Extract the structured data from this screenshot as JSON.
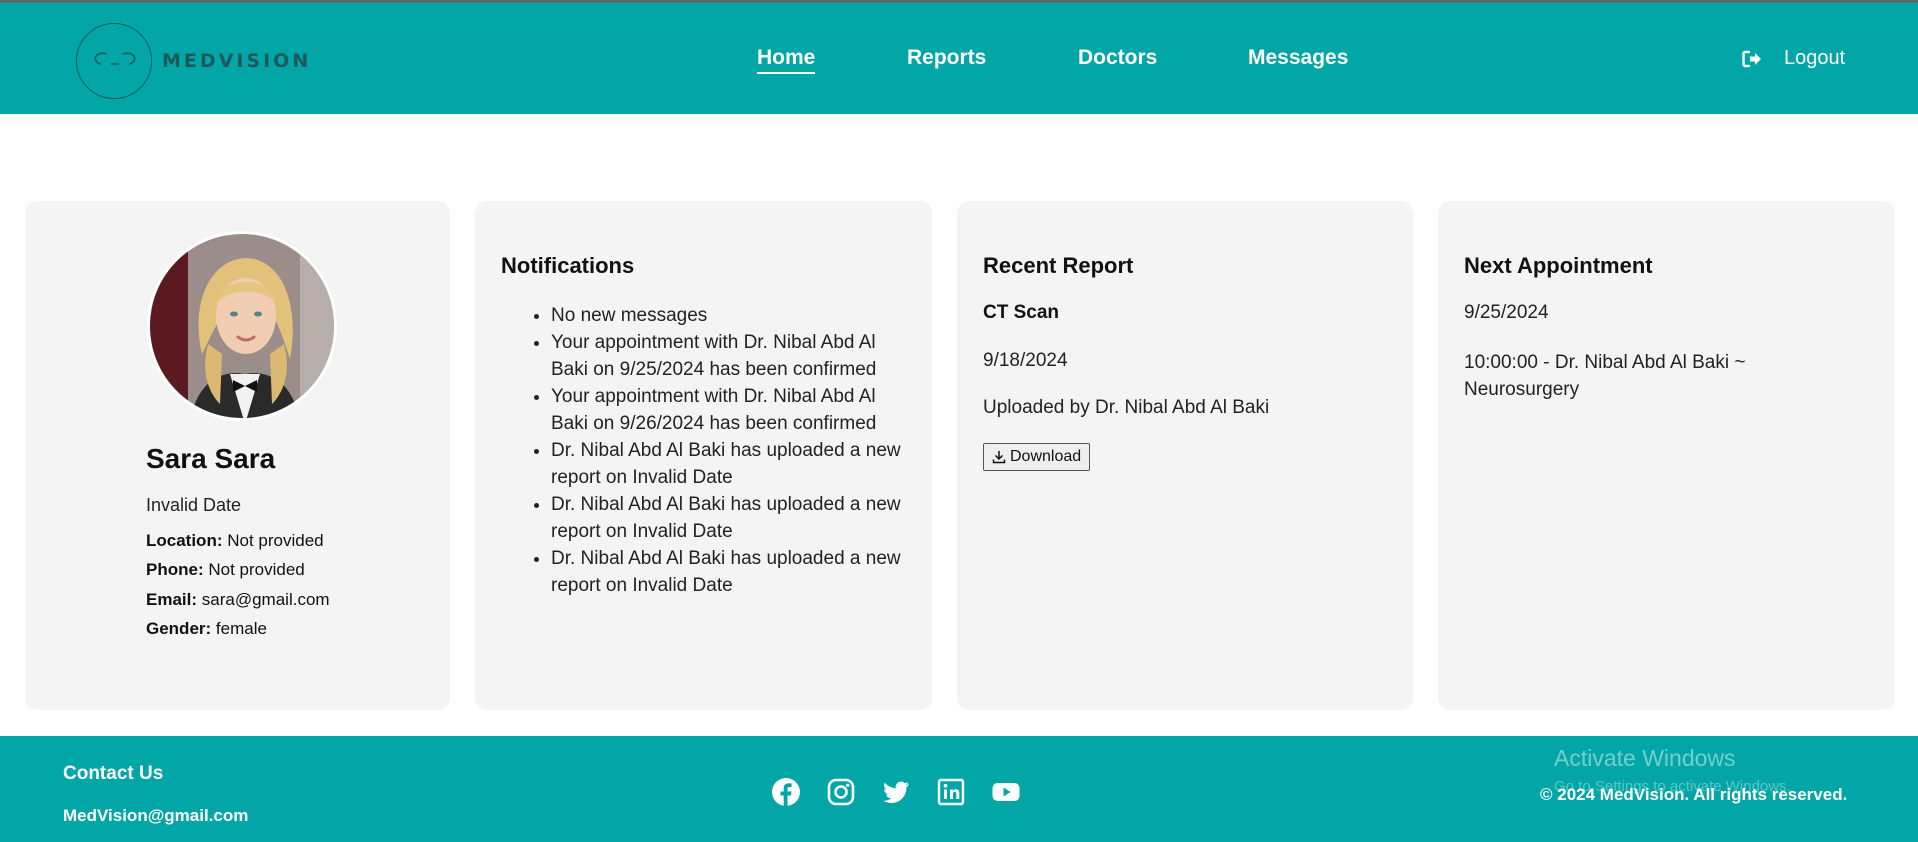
{
  "brand": {
    "name": "MEDVISION"
  },
  "nav": {
    "items": [
      {
        "label": "Home",
        "active": true
      },
      {
        "label": "Reports"
      },
      {
        "label": "Doctors"
      },
      {
        "label": "Messages"
      }
    ],
    "logout_label": "Logout"
  },
  "profile": {
    "name": "Sara Sara",
    "dob": "Invalid Date",
    "fields": [
      {
        "label": "Location:",
        "value": "Not provided"
      },
      {
        "label": "Phone:",
        "value": "Not provided"
      },
      {
        "label": "Email:",
        "value": "sara@gmail.com"
      },
      {
        "label": "Gender:",
        "value": "female"
      }
    ]
  },
  "notifications": {
    "title": "Notifications",
    "items": [
      "No new messages",
      "Your appointment with Dr. Nibal Abd Al Baki on 9/25/2024 has been confirmed",
      "Your appointment with Dr. Nibal Abd Al Baki on 9/26/2024 has been confirmed",
      "Dr. Nibal Abd Al Baki has uploaded a new report on Invalid Date",
      "Dr. Nibal Abd Al Baki has uploaded a new report on Invalid Date",
      "Dr. Nibal Abd Al Baki has uploaded a new report on Invalid Date"
    ]
  },
  "recent_report": {
    "title": "Recent Report",
    "type": "CT Scan",
    "date": "9/18/2024",
    "uploaded_by": "Uploaded by Dr. Nibal Abd Al Baki",
    "download_label": "Download"
  },
  "next_appointment": {
    "title": "Next Appointment",
    "date": "9/25/2024",
    "detail": "10:00:00 - Dr. Nibal Abd Al Baki ~ Neurosurgery"
  },
  "footer": {
    "contact_label": "Contact Us",
    "email": "MedVision@gmail.com",
    "socials": [
      "facebook-icon",
      "instagram-icon",
      "twitter-icon",
      "linkedin-icon",
      "youtube-icon"
    ],
    "copyright": "© 2024 MedVision. All rights reserved."
  },
  "os_overlay": {
    "title": "Activate Windows",
    "subtitle": "Go to Settings to activate Windows."
  },
  "colors": {
    "brand_teal": "#03a6a6",
    "card_bg": "#f4f4f4",
    "logo_dark": "#1c5a5a"
  }
}
